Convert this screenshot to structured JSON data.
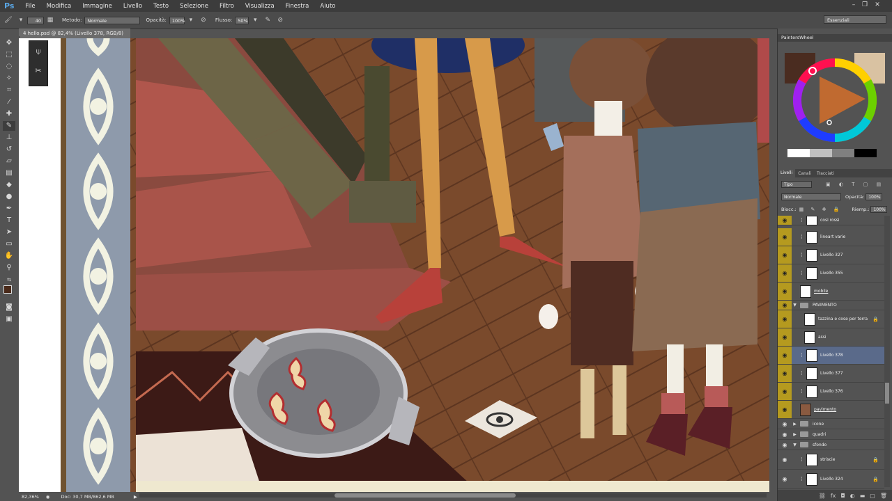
{
  "app": {
    "logo": "Ps",
    "menu": [
      "File",
      "Modifica",
      "Immagine",
      "Livello",
      "Testo",
      "Selezione",
      "Filtro",
      "Visualizza",
      "Finestra",
      "Aiuto"
    ]
  },
  "options": {
    "brush_size": "40",
    "method_label": "Metodo:",
    "method_value": "Normale",
    "opacity_label": "Opacità:",
    "opacity_value": "100%",
    "flow_label": "Flusso:",
    "flow_value": "50%",
    "workspace": "Essenziali"
  },
  "document": {
    "tab_title": "4 hello.psd @ 82,4% (Livello 378, RGB/8)"
  },
  "status": {
    "zoom": "82,36%",
    "doc_info": "Doc: 30,7 MB/862,6 MB"
  },
  "painterswheel": {
    "title": "PaintersWheel"
  },
  "layers_panel": {
    "tabs": [
      "Livelli",
      "Canali",
      "Tracciati"
    ],
    "filter": "Tipo",
    "blend_mode": "Normale",
    "opacity_label": "Opacità:",
    "opacity_value": "100%",
    "lock_label": "Blocc.:",
    "fill_label": "Riemp.:",
    "fill_value": "100%",
    "layers": [
      {
        "name": "cosi rossi"
      },
      {
        "name": "lineart varie"
      },
      {
        "name": "Livello 327"
      },
      {
        "name": "Livello 355"
      },
      {
        "name": "mobile"
      },
      {
        "name": "PAVIMENTO"
      },
      {
        "name": "tazzina e cose per terra"
      },
      {
        "name": "assi"
      },
      {
        "name": "Livello 378"
      },
      {
        "name": "Livello 377"
      },
      {
        "name": "Livello 376"
      },
      {
        "name": "pavimento"
      },
      {
        "name": "icone"
      },
      {
        "name": "quadri"
      },
      {
        "name": "sfondo"
      },
      {
        "name": "striscie"
      },
      {
        "name": "Livello 324"
      }
    ]
  },
  "colors": {
    "foreground": "#4a2a1a",
    "background": "#c9a66b",
    "wheel_base": "#4a2c20",
    "wheel_preview": "#d9c2a2"
  }
}
